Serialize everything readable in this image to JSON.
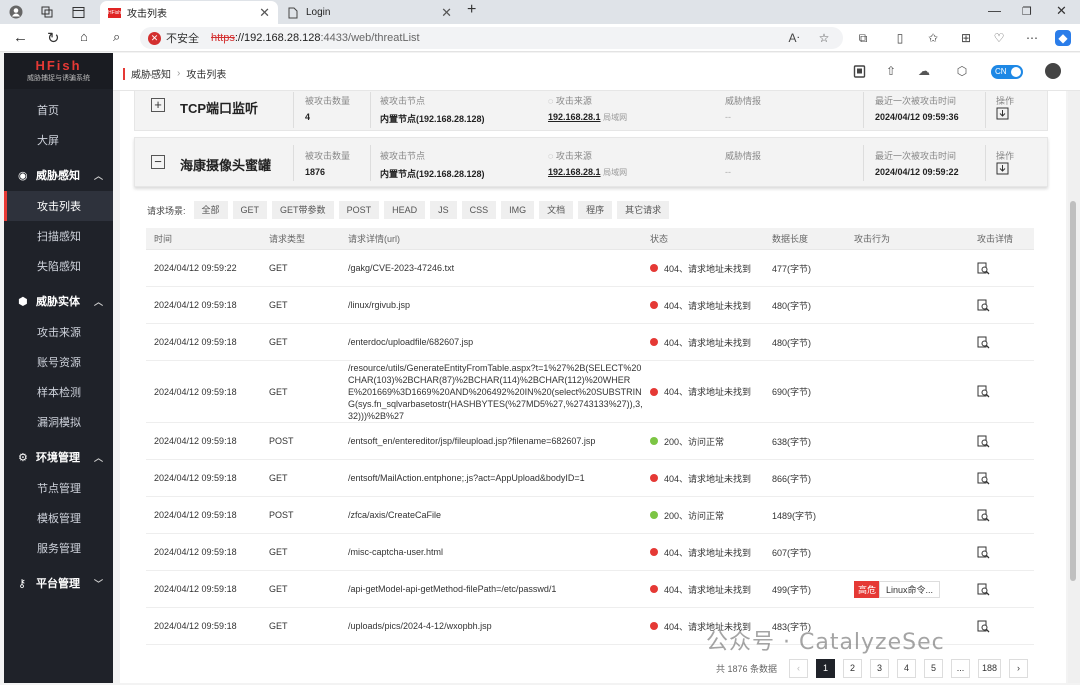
{
  "browser": {
    "tab_title": "攻击列表",
    "tab2_title": "Login",
    "url_warning": "不安全",
    "url_protocol": "https",
    "url_host": "://192.168.28.128",
    "url_path": ":4433/web/threatList",
    "favicon_text": "HFish"
  },
  "logo": {
    "title": "HFish",
    "subtitle": "威胁捕捉与诱骗系统"
  },
  "sidebar": {
    "top_items": [
      {
        "label": "首页"
      },
      {
        "label": "大屏"
      }
    ],
    "groups": [
      {
        "label": "威胁感知",
        "items": [
          {
            "label": "攻击列表"
          },
          {
            "label": "扫描感知"
          },
          {
            "label": "失陷感知"
          }
        ]
      },
      {
        "label": "威胁实体",
        "items": [
          {
            "label": "攻击来源"
          },
          {
            "label": "账号资源"
          },
          {
            "label": "样本检测"
          },
          {
            "label": "漏洞模拟"
          }
        ]
      },
      {
        "label": "环境管理",
        "items": [
          {
            "label": "节点管理"
          },
          {
            "label": "模板管理"
          },
          {
            "label": "服务管理"
          }
        ]
      },
      {
        "label": "平台管理",
        "items": []
      }
    ]
  },
  "header": {
    "breadcrumb": [
      "威胁感知",
      "攻击列表"
    ],
    "lang": "CN",
    "sep": "›"
  },
  "cards": [
    {
      "name": "TCP端口监听",
      "count_label": "被攻击数量",
      "count": "4",
      "node_label": "被攻击节点",
      "node": "内置节点(192.168.28.128)",
      "src_label": "攻击来源",
      "src_ip": "192.168.28.1",
      "src_note": "局域网",
      "intel_label": "威胁情报",
      "intel": "--",
      "last_label": "最近一次被攻击时间",
      "last_time": "2024/04/12 09:59:36",
      "op_label": "操作",
      "toggle": "+"
    },
    {
      "name": "海康摄像头蜜罐",
      "count_label": "被攻击数量",
      "count": "1876",
      "node_label": "被攻击节点",
      "node": "内置节点(192.168.28.128)",
      "src_label": "攻击来源",
      "src_ip": "192.168.28.1",
      "src_note": "局域网",
      "intel_label": "威胁情报",
      "intel": "--",
      "last_label": "最近一次被攻击时间",
      "last_time": "2024/04/12 09:59:22",
      "op_label": "操作",
      "toggle": "−"
    }
  ],
  "filter": {
    "label": "请求场景:",
    "chips": [
      "全部",
      "GET",
      "GET带参数",
      "POST",
      "HEAD",
      "JS",
      "CSS",
      "IMG",
      "文档",
      "程序",
      "其它请求"
    ]
  },
  "table": {
    "headers": [
      "时间",
      "请求类型",
      "请求详情(url)",
      "状态",
      "数据长度",
      "攻击行为",
      "攻击详情"
    ],
    "rows": [
      {
        "time": "2024/04/12 09:59:22",
        "method": "GET",
        "url": "/gakg/CVE-2023-47246.txt",
        "status_color": "#e53935",
        "status": "404、请求地址未找到",
        "len": "477(字节)",
        "tag": "",
        "tag_text": ""
      },
      {
        "time": "2024/04/12 09:59:18",
        "method": "GET",
        "url": "/linux/rgivub.jsp",
        "status_color": "#e53935",
        "status": "404、请求地址未找到",
        "len": "480(字节)",
        "tag": "",
        "tag_text": ""
      },
      {
        "time": "2024/04/12 09:59:18",
        "method": "GET",
        "url": "/enterdoc/uploadfile/682607.jsp",
        "status_color": "#e53935",
        "status": "404、请求地址未找到",
        "len": "480(字节)",
        "tag": "",
        "tag_text": ""
      },
      {
        "time": "2024/04/12 09:59:18",
        "method": "GET",
        "url": "/resource/utils/GenerateEntityFromTable.aspx?t=1%27%2B(SELECT%20CHAR(103)%2BCHAR(87)%2BCHAR(114)%2BCHAR(112)%20WHERE%201669%3D1669%20AND%206492%20IN%20(select%20SUBSTRING(sys.fn_sqlvarbasetostr(HASHBYTES(%27MD5%27,%2743133%27)),3,32)))%2B%27",
        "status_color": "#e53935",
        "status": "404、请求地址未找到",
        "len": "690(字节)",
        "tag": "",
        "tag_text": ""
      },
      {
        "time": "2024/04/12 09:59:18",
        "method": "POST",
        "url": "/entsoft_en/entereditor/jsp/fileupload.jsp?filename=682607.jsp",
        "status_color": "#7cc544",
        "status": "200、访问正常",
        "len": "638(字节)",
        "tag": "",
        "tag_text": ""
      },
      {
        "time": "2024/04/12 09:59:18",
        "method": "GET",
        "url": "/entsoft/MailAction.entphone;.js?act=AppUpload&bodyID=1",
        "status_color": "#e53935",
        "status": "404、请求地址未找到",
        "len": "866(字节)",
        "tag": "",
        "tag_text": ""
      },
      {
        "time": "2024/04/12 09:59:18",
        "method": "POST",
        "url": "/zfca/axis/CreateCaFile",
        "status_color": "#7cc544",
        "status": "200、访问正常",
        "len": "1489(字节)",
        "tag": "",
        "tag_text": ""
      },
      {
        "time": "2024/04/12 09:59:18",
        "method": "GET",
        "url": "/misc-captcha-user.html",
        "status_color": "#e53935",
        "status": "404、请求地址未找到",
        "len": "607(字节)",
        "tag": "",
        "tag_text": ""
      },
      {
        "time": "2024/04/12 09:59:18",
        "method": "GET",
        "url": "/api-getModel-api-getMethod-filePath=/etc/passwd/1",
        "status_color": "#e53935",
        "status": "404、请求地址未找到",
        "len": "499(字节)",
        "tag": "高危",
        "tag_text": "Linux命令..."
      },
      {
        "time": "2024/04/12 09:59:18",
        "method": "GET",
        "url": "/uploads/pics/2024-4-12/wxopbh.jsp",
        "status_color": "#e53935",
        "status": "404、请求地址未找到",
        "len": "483(字节)",
        "tag": "",
        "tag_text": ""
      }
    ]
  },
  "pagination": {
    "total": "共 1876 条数据",
    "pages": [
      "1",
      "2",
      "3",
      "4",
      "5",
      "...",
      "188"
    ],
    "current": "1"
  },
  "watermark": "公众号 · CatalyzeSec",
  "colors": {
    "accent": "#e53935",
    "sidebar_bg": "#1f2229",
    "ok": "#7cc544",
    "lang_toggle": "#1e88e5"
  }
}
